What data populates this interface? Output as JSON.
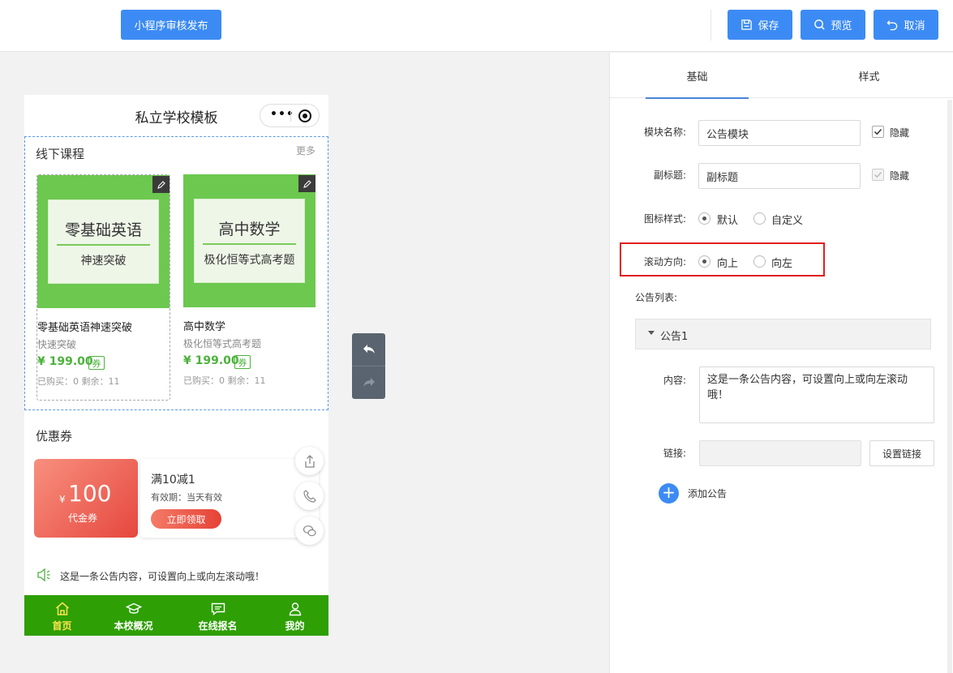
{
  "topbar": {
    "publish_label": "小程序审核发布",
    "save_label": "保存",
    "preview_label": "预览",
    "cancel_label": "取消"
  },
  "phone": {
    "title": "私立学校模板",
    "course_section": {
      "title": "线下课程",
      "more": "更多",
      "courses": [
        {
          "img_big": "零基础英语",
          "img_small": "神速突破",
          "name": "零基础英语神速突破",
          "subtitle": "快速突破",
          "price": "¥ 199.00",
          "coupon": "券",
          "stock": "已购买：0 剩余：11"
        },
        {
          "img_big": "高中数学",
          "img_small": "极化恒等式高考题",
          "name": "高中数学",
          "subtitle": "极化恒等式高考题",
          "price": "¥ 199.00",
          "coupon": "券",
          "stock": "已购买：0 剩余：11"
        }
      ]
    },
    "coupon_section": {
      "title": "优惠券",
      "currency": "¥",
      "amount": "100",
      "type_label": "代金券",
      "name": "满10减1",
      "validity": "有效期：当天有效",
      "claim_label": "立即领取"
    },
    "notice_text": "这是一条公告内容，可设置向上或向左滚动哦！",
    "tabbar": [
      {
        "label": "首页"
      },
      {
        "label": "本校概况"
      },
      {
        "label": "在线报名"
      },
      {
        "label": "我的"
      }
    ]
  },
  "panel": {
    "tabs": [
      {
        "label": "基础"
      },
      {
        "label": "样式"
      }
    ],
    "module_name_label": "模块名称:",
    "module_name_value": "公告模块",
    "hide_label": "隐藏",
    "subtitle_label": "副标题:",
    "subtitle_value": "副标题",
    "hide_label_2": "隐藏",
    "icon_style_label": "图标样式:",
    "icon_style_options": [
      "默认",
      "自定义"
    ],
    "scroll_dir_label": "滚动方向:",
    "scroll_dir_options": [
      "向上",
      "向左"
    ],
    "notice_list_label": "公告列表:",
    "notice_item_title": "公告1",
    "content_label": "内容:",
    "content_value": "这是一条公告内容，可设置向上或向左滚动哦！",
    "link_label": "链接:",
    "set_link_label": "设置链接",
    "add_notice_label": "添加公告"
  },
  "colors": {
    "primary": "#3c8bf4",
    "tabbar_green": "#2e9f04",
    "price_green": "#4cb23c",
    "highlight_red": "#e02020"
  }
}
